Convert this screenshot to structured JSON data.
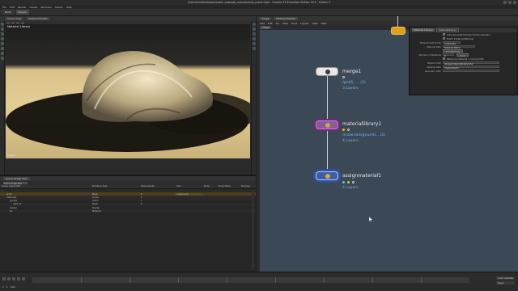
{
  "window": {
    "title": "/Users/kim/Desktop/houdini_example_scene/solaris_scene.hiplc - Houdini FX Education Edition 19.0 - Python 3"
  },
  "menu": [
    "File",
    "Edit",
    "Render",
    "Assets",
    "Windows",
    "Solaris",
    "Help"
  ],
  "shelf_tabs": [
    "Build",
    "Solaris"
  ],
  "viewport": {
    "tabs": [
      "Scene View",
      "Material Palette"
    ],
    "label": "Material Library",
    "persp": "Persp",
    "camera": "No cam",
    "corner": "Karma",
    "footer": "Solaris"
  },
  "tree_panel": {
    "tab": "Scene Graph Tree",
    "filter": "Scene Graph Tree",
    "columns": [
      "Scene Graph Path",
      "Primitive Type",
      "Descendants",
      "Kind",
      "Draw",
      "Draw Mode",
      "Purpose"
    ],
    "rows": [
      {
        "path": "/",
        "type": "",
        "desc": "",
        "kind": "",
        "sel": false
      },
      {
        "path": "grid1",
        "type": "Mesh",
        "desc": "2",
        "kind": "component",
        "sel": true
      },
      {
        "path": "materials",
        "type": "Scope",
        "desc": "2",
        "kind": "",
        "sel": false
      },
      {
        "path": "gnome",
        "type": "Xform",
        "desc": "1",
        "kind": "",
        "sel": false
      },
      {
        "path": "mesh_0",
        "type": "Mesh",
        "desc": "0",
        "kind": "",
        "sel": false
      },
      {
        "path": "shader",
        "type": "Shader",
        "desc": "",
        "kind": "",
        "sel": false
      },
      {
        "path": "fur",
        "type": "Material",
        "desc": "",
        "kind": "",
        "sel": false
      }
    ]
  },
  "network": {
    "tabs": [
      "/stage",
      "Material Palette"
    ],
    "menu": [
      "Add",
      "Edit",
      "Go",
      "View",
      "Tools",
      "Layout",
      "Labs",
      "Help"
    ],
    "path": "stage",
    "nodes": [
      {
        "name": "merge1",
        "sub1": "/grid1, ... (3)",
        "sub2": "3 Layers"
      },
      {
        "name": "materiallibrary1",
        "sub1": "/materials/gnum0... (2)",
        "sub2": "4 Layers"
      },
      {
        "name": "assignmaterial1",
        "sub1": "",
        "sub2": "4 Layers"
      }
    ]
  },
  "params": {
    "tab": "Material Library",
    "node_field": "materiallibrary1",
    "rows": [
      {
        "label": "",
        "value": "Auto-generate Preview Surface Shaders"
      },
      {
        "label": "",
        "value": "Match Existing Materials"
      },
      {
        "label": "Material Path Prefix",
        "value": "/materials/"
      },
      {
        "label": "Material Path",
        "value": "Material Path1"
      },
      {
        "label": "",
        "value": "Fill Materials"
      },
      {
        "label": "Number of Materials",
        "value": "2"
      },
      {
        "label": "",
        "value": "Reference Material in Current Edit"
      },
      {
        "label": "Material VOP",
        "value": "/stage/materiallibrary1/fur"
      },
      {
        "label": "Material Path",
        "value": "/materials/fur"
      },
      {
        "label": "Geometry Path",
        "value": ""
      }
    ],
    "buttons": {
      "clear": "Clear"
    }
  },
  "timeline": {
    "frame": "1",
    "start": "1",
    "end": "240",
    "labels": [
      "Auto Update",
      "Keys"
    ]
  }
}
